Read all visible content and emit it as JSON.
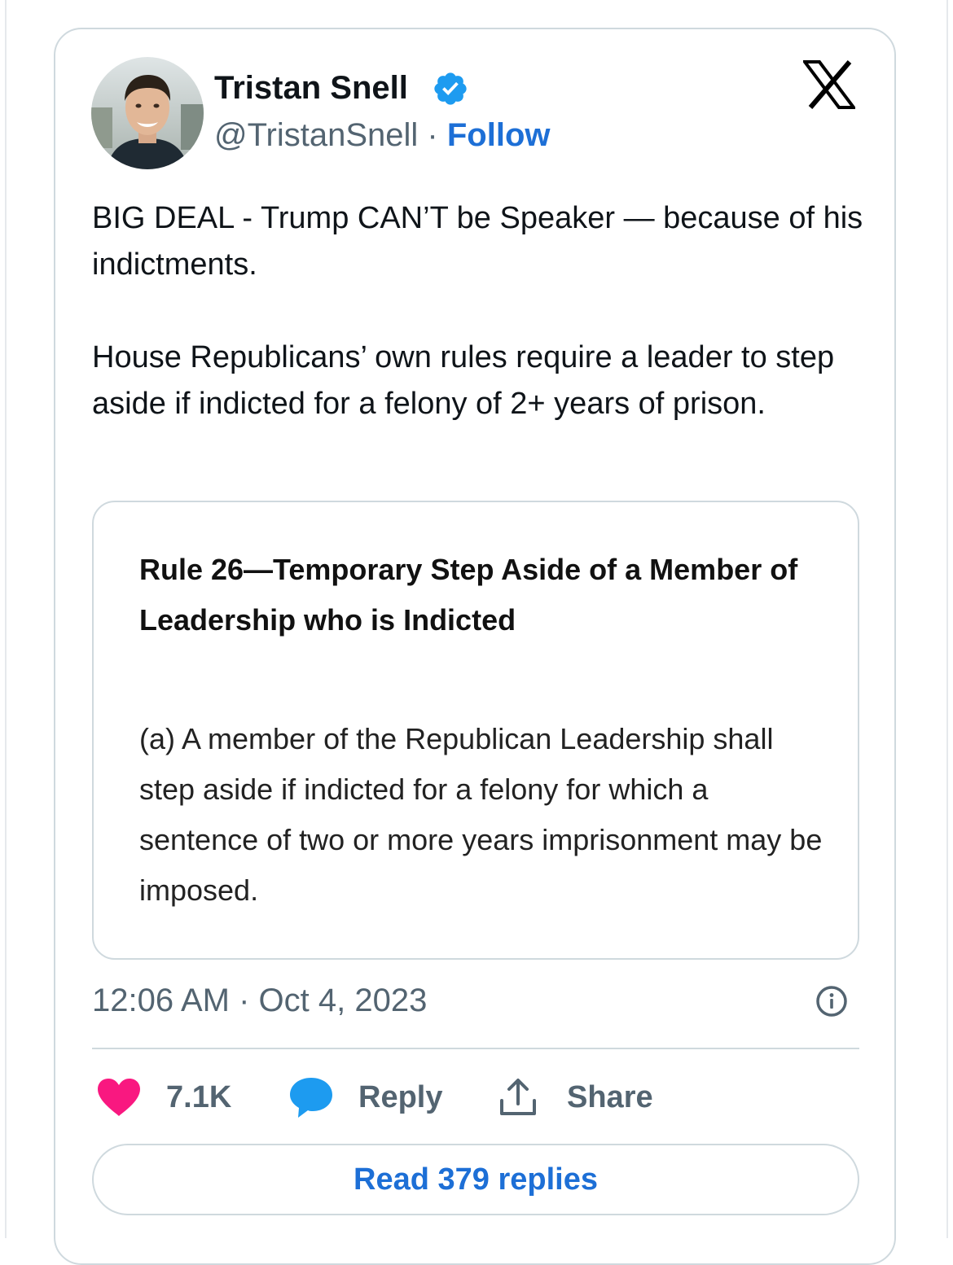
{
  "author": {
    "name": "Tristan Snell",
    "handle": "@TristanSnell",
    "separator": " · ",
    "follow_label": "Follow",
    "verified": true,
    "badge_color": "#1d9bf0"
  },
  "platform_icon": "x-logo-icon",
  "tweet": {
    "paragraphs": [
      "BIG DEAL - Trump CAN’T be Speaker — because of his indictments.",
      "House Republicans’ own rules require a leader to step aside if indicted for a felony of 2+ years of prison."
    ]
  },
  "quoted_image": {
    "title": "Rule 26—Temporary Step Aside of a Member of Leadership who is Indicted",
    "body": "(a) A member of the Republican Leadership shall step aside if indicted for a felony for which a sentence of two or more years imprisonment may be imposed."
  },
  "timestamp": "12:06 AM · Oct 4, 2023",
  "info_icon": "info-icon",
  "actions": {
    "like": {
      "icon": "heart-icon",
      "count": "7.1K",
      "color": "#f91880"
    },
    "reply": {
      "icon": "speech-bubble-icon",
      "label": "Reply",
      "color": "#1d9bf0"
    },
    "share": {
      "icon": "share-upload-icon",
      "label": "Share"
    }
  },
  "read_replies_label": "Read 379 replies",
  "colors": {
    "link": "#1d6fd6",
    "secondary_text": "#536471",
    "border": "#cfd9de"
  }
}
